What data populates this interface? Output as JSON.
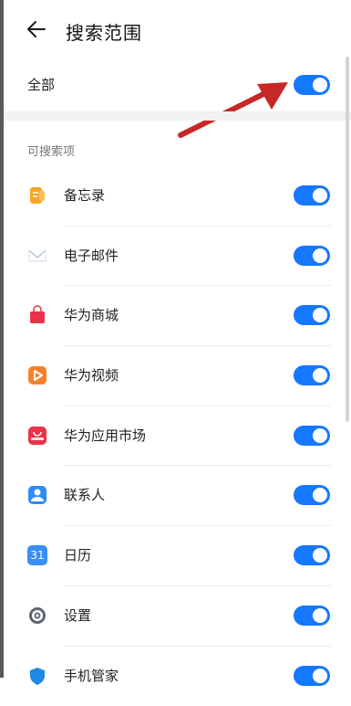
{
  "header": {
    "title": "搜索范围",
    "back_icon": "arrow-left-icon"
  },
  "all_row": {
    "label": "全部",
    "enabled": true
  },
  "section_title": "可搜索项",
  "items": [
    {
      "label": "备忘录",
      "icon": "memo-icon",
      "icon_color": "#f6a623",
      "enabled": true
    },
    {
      "label": "电子邮件",
      "icon": "email-icon",
      "icon_color": "#9fb3c8",
      "enabled": true
    },
    {
      "label": "华为商城",
      "icon": "shopping-bag-icon",
      "icon_color": "#e8334a",
      "enabled": true
    },
    {
      "label": "华为视频",
      "icon": "video-play-icon",
      "icon_color": "#f5822a",
      "enabled": true
    },
    {
      "label": "华为应用市场",
      "icon": "app-gallery-icon",
      "icon_color": "#e8334a",
      "enabled": true
    },
    {
      "label": "联系人",
      "icon": "contacts-icon",
      "icon_color": "#2f8cf6",
      "enabled": true
    },
    {
      "label": "日历",
      "icon": "calendar-icon",
      "icon_color": "#3a8ff7",
      "icon_text": "31",
      "enabled": true
    },
    {
      "label": "设置",
      "icon": "settings-gear-icon",
      "icon_color": "#5b6675",
      "enabled": true
    },
    {
      "label": "手机管家",
      "icon": "phone-manager-shield-icon",
      "icon_color": "#1e88e5",
      "enabled": true
    }
  ],
  "annotation_arrow_color": "#c62828",
  "accent": "#1677ff"
}
